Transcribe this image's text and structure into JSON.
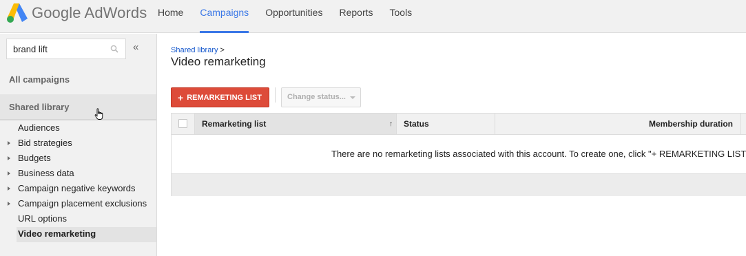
{
  "app": {
    "logo_text": "Google AdWords",
    "brand_colors": {
      "blue": "#4285f4",
      "green": "#34a853",
      "yellow": "#fbbc05",
      "accent": "#3b78e7",
      "red_button": "#dd4b39"
    }
  },
  "nav": {
    "items": [
      {
        "label": "Home",
        "active": false
      },
      {
        "label": "Campaigns",
        "active": true
      },
      {
        "label": "Opportunities",
        "active": false
      },
      {
        "label": "Reports",
        "active": false
      },
      {
        "label": "Tools",
        "active": false
      }
    ]
  },
  "sidebar": {
    "search": {
      "value": "brand lift",
      "icon": "search-icon"
    },
    "collapse_label": "«",
    "all_campaigns": "All campaigns",
    "shared_library": "Shared library",
    "items": [
      {
        "label": "Audiences",
        "expandable": false
      },
      {
        "label": "Bid strategies",
        "expandable": true
      },
      {
        "label": "Budgets",
        "expandable": true
      },
      {
        "label": "Business data",
        "expandable": true
      },
      {
        "label": "Campaign negative keywords",
        "expandable": true
      },
      {
        "label": "Campaign placement exclusions",
        "expandable": true
      },
      {
        "label": "URL options",
        "expandable": false
      },
      {
        "label": "Video remarketing",
        "expandable": false,
        "selected": true
      }
    ]
  },
  "main": {
    "breadcrumb": {
      "link": "Shared library",
      "separator": ">"
    },
    "title": "Video remarketing",
    "toolbar": {
      "add_label": "REMARKETING LIST",
      "add_icon": "+",
      "status_dropdown": "Change status..."
    },
    "table": {
      "columns": [
        "Remarketing list",
        "Status",
        "Membership duration"
      ],
      "sort_icon": "↑",
      "empty_message": "There are no remarketing lists associated with this account. To create one, click \"+ REMARKETING LIST"
    }
  }
}
